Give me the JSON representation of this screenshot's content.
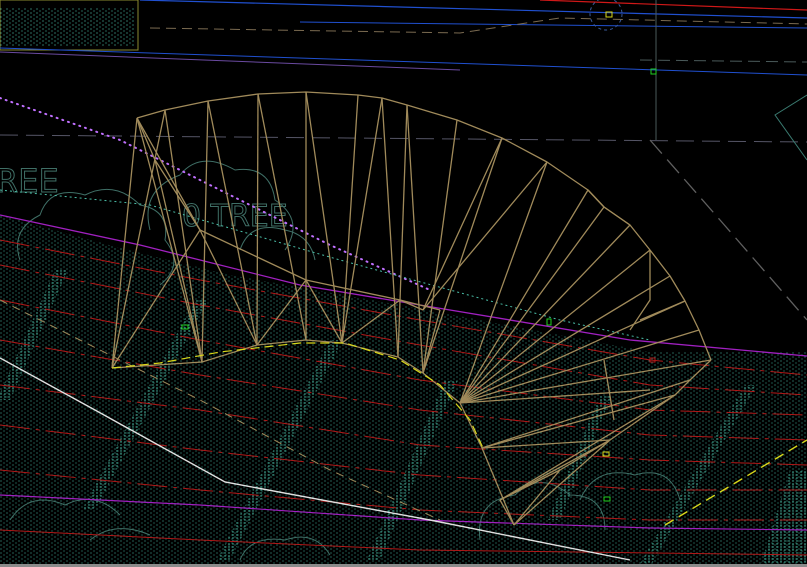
{
  "app": {
    "name": ""
  },
  "drawing": {
    "background": "#000000",
    "labels": {
      "tree_left": "REE",
      "tree_right": "0 TREE"
    },
    "colors": {
      "grading_lines": "#a08a5a",
      "hatch_dots": "#4bbfa8",
      "red_contour": "#b01818",
      "magenta_contour": "#a020c0",
      "yellow_dash": "#d8d81a",
      "white_line": "#e0e0e0",
      "purple_dots": "#c070ff",
      "blue_line": "#2050d0",
      "green_marker": "#20d020",
      "grey_dash": "#606060"
    }
  }
}
